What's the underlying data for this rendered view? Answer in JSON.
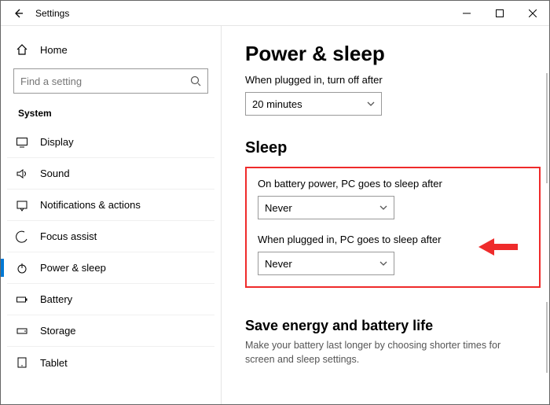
{
  "titlebar": {
    "title": "Settings"
  },
  "sidebar": {
    "home": "Home",
    "search_placeholder": "Find a setting",
    "section": "System",
    "items": [
      {
        "label": "Display"
      },
      {
        "label": "Sound"
      },
      {
        "label": "Notifications & actions"
      },
      {
        "label": "Focus assist"
      },
      {
        "label": "Power & sleep"
      },
      {
        "label": "Battery"
      },
      {
        "label": "Storage"
      },
      {
        "label": "Tablet"
      }
    ]
  },
  "main": {
    "title": "Power & sleep",
    "screen": {
      "plugged_label": "When plugged in, turn off after",
      "plugged_value": "20 minutes"
    },
    "sleep_heading": "Sleep",
    "sleep": {
      "battery_label": "On battery power, PC goes to sleep after",
      "battery_value": "Never",
      "plugged_label": "When plugged in, PC goes to sleep after",
      "plugged_value": "Never"
    },
    "energy": {
      "title": "Save energy and battery life",
      "subtitle": "Make your battery last longer by choosing shorter times for screen and sleep settings."
    }
  }
}
